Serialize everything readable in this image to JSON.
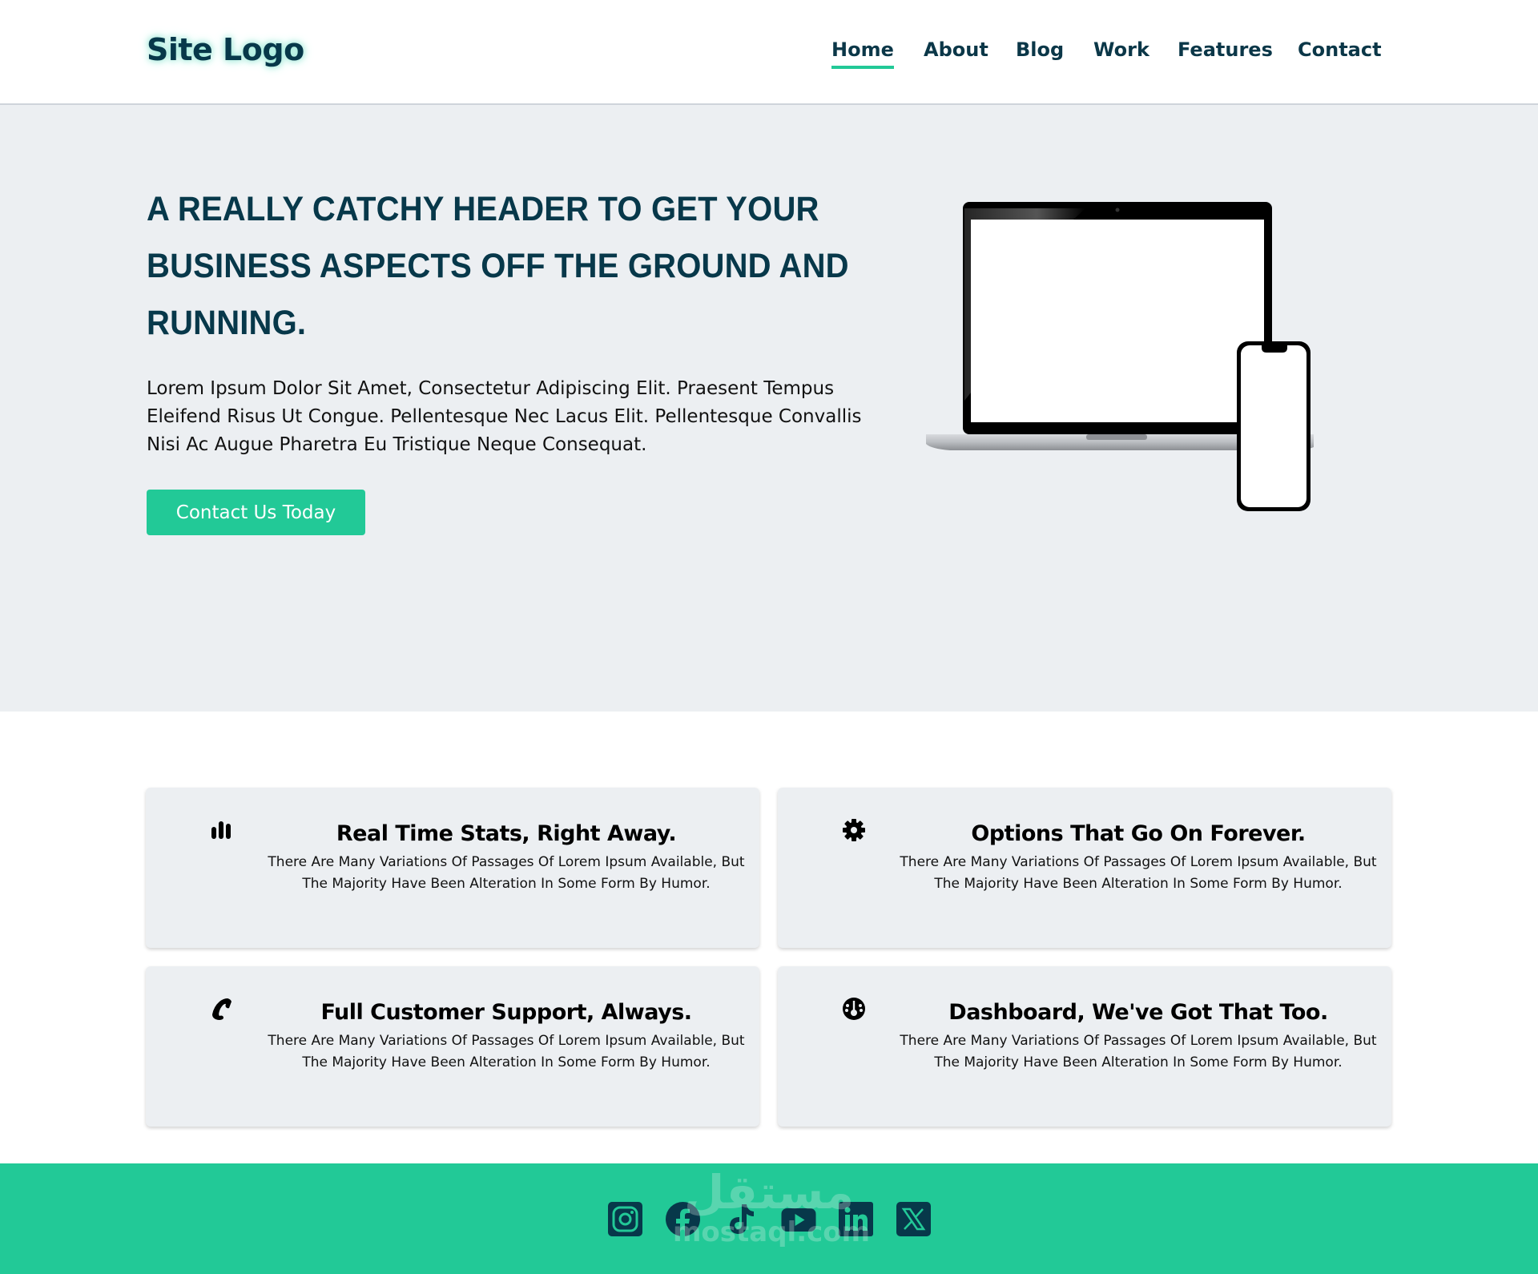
{
  "header": {
    "logo": "Site Logo",
    "nav": [
      {
        "label": "Home",
        "active": true
      },
      {
        "label": "About",
        "active": false
      },
      {
        "label": "Blog",
        "active": false
      },
      {
        "label": "Work",
        "active": false
      },
      {
        "label": "Features",
        "active": false
      },
      {
        "label": "Contact",
        "active": false
      }
    ]
  },
  "hero": {
    "title": "A Really Catchy Header To Get Your Business Aspects Off The Ground And Running.",
    "text": "Lorem Ipsum Dolor Sit Amet, Consectetur Adipiscing Elit. Praesent Tempus Eleifend Risus Ut Congue. Pellentesque Nec Lacus Elit. Pellentesque Convallis Nisi Ac Augue Pharetra Eu Tristique Neque Consequat.",
    "cta_label": "Contact Us Today",
    "image": "laptop-and-phone-mockup"
  },
  "features": [
    {
      "icon": "bar-chart-icon",
      "title": "Real Time Stats, Right Away.",
      "text": "There Are Many Variations Of Passages Of Lorem Ipsum Available, But The Majority Have Been Alteration In Some Form By Humor."
    },
    {
      "icon": "gear-icon",
      "title": "Options That Go On Forever.",
      "text": "There Are Many Variations Of Passages Of Lorem Ipsum Available, But The Majority Have Been Alteration In Some Form By Humor."
    },
    {
      "icon": "phone-icon",
      "title": "Full Customer Support, Always.",
      "text": "There Are Many Variations Of Passages Of Lorem Ipsum Available, But The Majority Have Been Alteration In Some Form By Humor."
    },
    {
      "icon": "dashboard-gauge-icon",
      "title": "Dashboard, We've Got That Too.",
      "text": "There Are Many Variations Of Passages Of Lorem Ipsum Available, But The Majority Have Been Alteration In Some Form By Humor."
    }
  ],
  "footer": {
    "socials": [
      "instagram",
      "facebook",
      "tiktok",
      "youtube",
      "linkedin",
      "x"
    ],
    "watermark_ar": "مستقل",
    "watermark_en": "mostaql.com"
  },
  "colors": {
    "brand_dark": "#07384a",
    "accent_green": "#22c997",
    "hero_bg": "#eceff2",
    "card_bg": "#eceff2"
  }
}
